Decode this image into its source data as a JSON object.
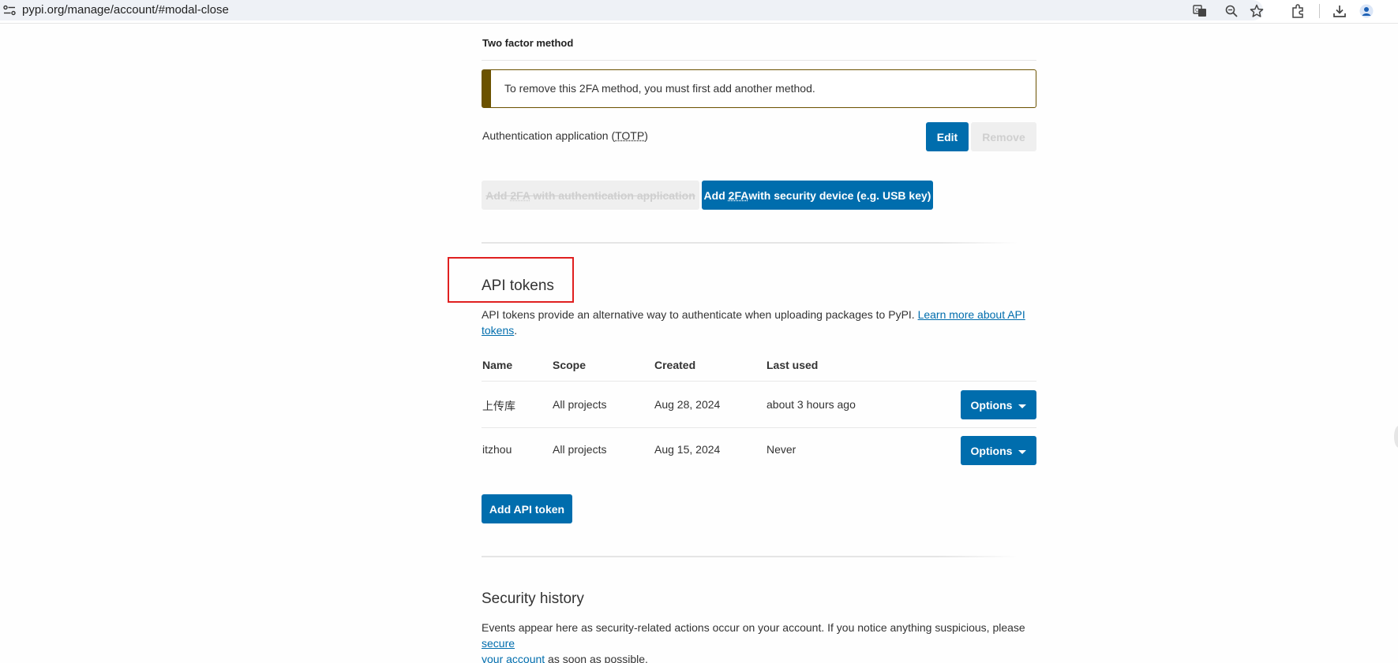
{
  "browser": {
    "url": "pypi.org/manage/account/#modal-close"
  },
  "two_factor": {
    "section_label": "Two factor method",
    "warning_text": "To remove this 2FA method, you must first add another method.",
    "auth_label_prefix": "Authentication application (",
    "auth_label_abbr": "TOTP",
    "auth_label_suffix": ")",
    "edit_label": "Edit",
    "remove_label": "Remove",
    "add_app_prefix": "Add ",
    "add_app_abbr": "2FA",
    "add_app_suffix": " with authentication application",
    "add_device_prefix": "Add ",
    "add_device_abbr": "2FA",
    "add_device_suffix": " with security device (e.g. USB key)"
  },
  "api_tokens": {
    "title": "API tokens",
    "description": "API tokens provide an alternative way to authenticate when uploading packages to PyPI. ",
    "learn_more_line1": "Learn more about API",
    "learn_more_line2": "tokens",
    "period": ".",
    "columns": [
      "Name",
      "Scope",
      "Created",
      "Last used"
    ],
    "rows": [
      {
        "name": "上传库",
        "scope": "All projects",
        "created": "Aug 28, 2024",
        "last_used": "about 3 hours ago",
        "options": "Options"
      },
      {
        "name": "itzhou",
        "scope": "All projects",
        "created": "Aug 15, 2024",
        "last_used": "Never",
        "options": "Options"
      }
    ],
    "add_button": "Add API token"
  },
  "security_history": {
    "title": "Security history",
    "text": "Events appear here as security-related actions occur on your account. If you notice anything suspicious, please ",
    "link_line1": "secure",
    "link_line2": "your account",
    "text_end": " as soon as possible."
  },
  "colors": {
    "primary": "#006dad",
    "warning_border": "#6b5200",
    "highlight": "#e02020"
  }
}
